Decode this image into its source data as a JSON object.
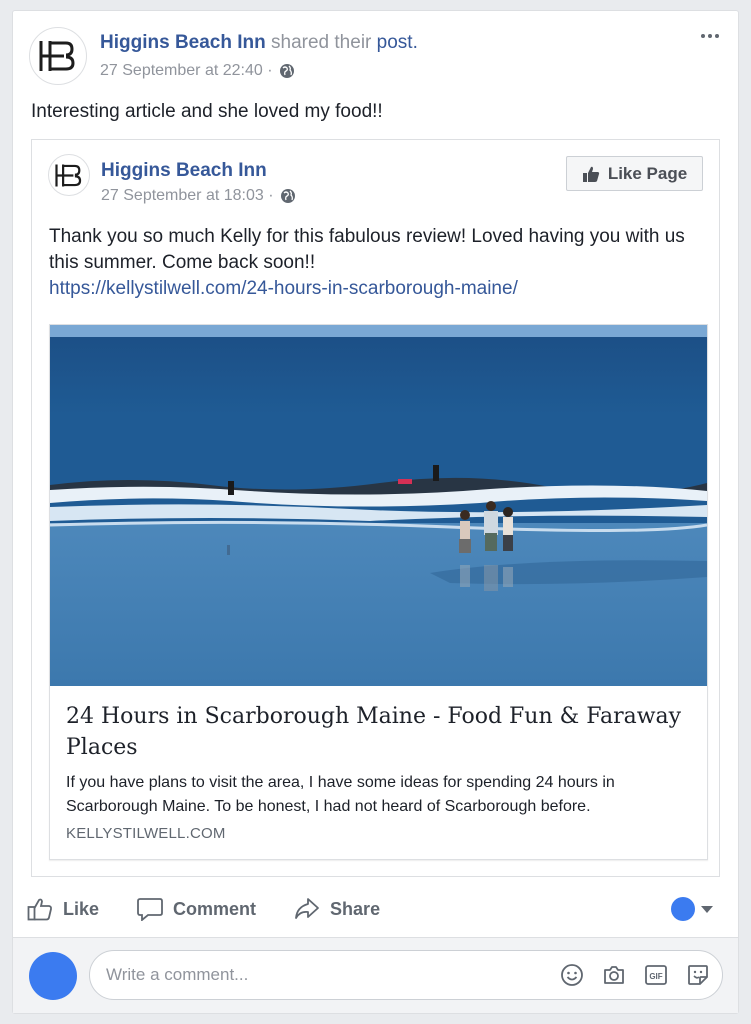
{
  "post": {
    "page_name": "Higgins Beach Inn",
    "shared_text": "shared their",
    "shared_link": "post.",
    "timestamp": "27 September at 22:40 ·",
    "text": "Interesting article and she loved my food!!"
  },
  "shared_post": {
    "page_name": "Higgins Beach Inn",
    "timestamp": "27 September at 18:03 ·",
    "like_page_label": "Like Page",
    "text": "Thank you so much Kelly for this fabulous review! Loved having you with us this summer. Come back soon!!",
    "url": "https://kellystilwell.com/24-hours-in-scarborough-maine/"
  },
  "link_card": {
    "title": "24 Hours in Scarborough Maine - Food Fun & Faraway Places",
    "description": "If you have plans to visit the area, I have some ideas for spending 24 hours in Scarborough Maine. To be honest, I had not heard of Scarborough before.",
    "domain": "KELLYSTILWELL.COM"
  },
  "actions": {
    "like": "Like",
    "comment": "Comment",
    "share": "Share"
  },
  "comment_box": {
    "placeholder": "Write a comment..."
  },
  "colors": {
    "link_blue": "#365899",
    "avatar_blue": "#3b7bf0"
  },
  "icons": [
    "hb-logo-icon",
    "globe-icon",
    "more-icon",
    "thumbs-up-icon",
    "like-icon",
    "comment-icon",
    "share-icon",
    "emoji-icon",
    "camera-icon",
    "gif-icon",
    "sticker-icon"
  ]
}
